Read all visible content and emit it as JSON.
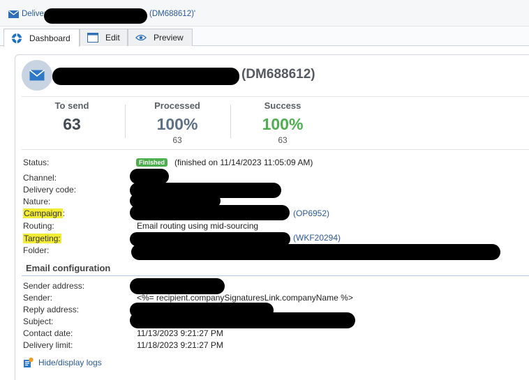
{
  "titlebar": {
    "prefix": "Deliver",
    "code_suffix": "(DM688612)'"
  },
  "tabs": [
    {
      "label": "Dashboard",
      "icon": "dashboard-icon",
      "active": true
    },
    {
      "label": "Edit",
      "icon": "edit-window-icon",
      "active": false
    },
    {
      "label": "Preview",
      "icon": "eye-icon",
      "active": false
    }
  ],
  "header": {
    "code": "(DM688612)"
  },
  "stats": {
    "to_send": {
      "label": "To send",
      "value": "63"
    },
    "processed": {
      "label": "Processed",
      "value": "100%",
      "count": "63"
    },
    "success": {
      "label": "Success",
      "value": "100%",
      "count": "63"
    }
  },
  "details": {
    "status_label": "Status:",
    "status_badge": "Finished",
    "status_text": "(finished on 11/14/2023 11:05:09 AM)",
    "channel_label": "Channel:",
    "delivery_code_label": "Delivery code:",
    "nature_label": "Nature:",
    "campaign_label": "Campaign",
    "campaign_colon": ":",
    "campaign_code": "(OP6952)",
    "routing_label": "Routing:",
    "routing_value": "Email routing using mid-sourcing",
    "targeting_label": "Targeting:",
    "targeting_code": "(WKF20294)",
    "folder_label": "Folder:"
  },
  "email_config": {
    "title": "Email configuration",
    "sender_address_label": "Sender address:",
    "sender_label": "Sender:",
    "sender_value": "<%= recipient.companySignaturesLink.companyName %>",
    "reply_address_label": "Reply address:",
    "subject_label": "Subject:",
    "contact_date_label": "Contact date:",
    "contact_date_value": "11/13/2023 9:21:27 PM",
    "delivery_limit_label": "Delivery limit:",
    "delivery_limit_value": "11/18/2023 9:21:27 PM"
  },
  "logs_link": "Hide/display logs",
  "colors": {
    "accent": "#2a5a9a",
    "success": "#4cae4c",
    "highlight": "#f2ec35",
    "redaction": "#000000"
  }
}
